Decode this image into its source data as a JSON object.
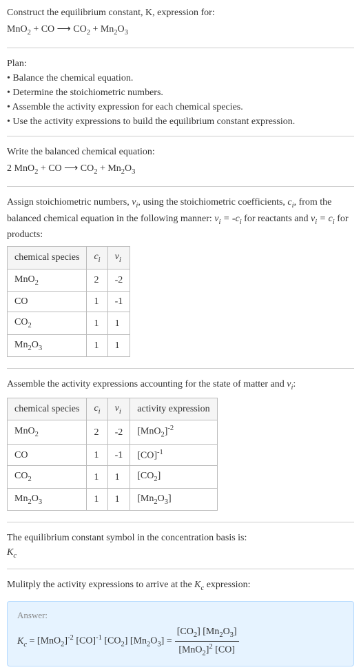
{
  "intro": {
    "line1": "Construct the equilibrium constant, K, expression for:",
    "equation": "MnO₂ + CO ⟶ CO₂ + Mn₂O₃"
  },
  "plan": {
    "heading": "Plan:",
    "items": [
      "• Balance the chemical equation.",
      "• Determine the stoichiometric numbers.",
      "• Assemble the activity expression for each chemical species.",
      "• Use the activity expressions to build the equilibrium constant expression."
    ]
  },
  "balanced": {
    "heading": "Write the balanced chemical equation:",
    "equation": "2 MnO₂ + CO ⟶ CO₂ + Mn₂O₃"
  },
  "assign": {
    "text_before": "Assign stoichiometric numbers, ",
    "var1": "νᵢ",
    "text_mid1": ", using the stoichiometric coefficients, ",
    "var2": "cᵢ",
    "text_mid2": ", from the balanced chemical equation in the following manner: ",
    "rel1": "νᵢ = -cᵢ",
    "text_mid3": " for reactants and ",
    "rel2": "νᵢ = cᵢ",
    "text_after": " for products:",
    "table": {
      "headers": [
        "chemical species",
        "cᵢ",
        "νᵢ"
      ],
      "rows": [
        [
          "MnO₂",
          "2",
          "-2"
        ],
        [
          "CO",
          "1",
          "-1"
        ],
        [
          "CO₂",
          "1",
          "1"
        ],
        [
          "Mn₂O₃",
          "1",
          "1"
        ]
      ]
    }
  },
  "activity": {
    "heading_before": "Assemble the activity expressions accounting for the state of matter and ",
    "heading_var": "νᵢ",
    "heading_after": ":",
    "table": {
      "headers": [
        "chemical species",
        "cᵢ",
        "νᵢ",
        "activity expression"
      ],
      "rows": [
        [
          "MnO₂",
          "2",
          "-2",
          "[MnO₂]⁻²"
        ],
        [
          "CO",
          "1",
          "-1",
          "[CO]⁻¹"
        ],
        [
          "CO₂",
          "1",
          "1",
          "[CO₂]"
        ],
        [
          "Mn₂O₃",
          "1",
          "1",
          "[Mn₂O₃]"
        ]
      ]
    }
  },
  "symbol": {
    "line1": "The equilibrium constant symbol in the concentration basis is:",
    "line2": "K_c"
  },
  "multiply": {
    "heading_before": "Mulitply the activity expressions to arrive at the ",
    "heading_var": "K_c",
    "heading_after": " expression:"
  },
  "answer": {
    "label": "Answer:",
    "lhs": "K_c = [MnO₂]⁻² [CO]⁻¹ [CO₂] [Mn₂O₃] = ",
    "frac_num": "[CO₂] [Mn₂O₃]",
    "frac_den": "[MnO₂]² [CO]"
  }
}
